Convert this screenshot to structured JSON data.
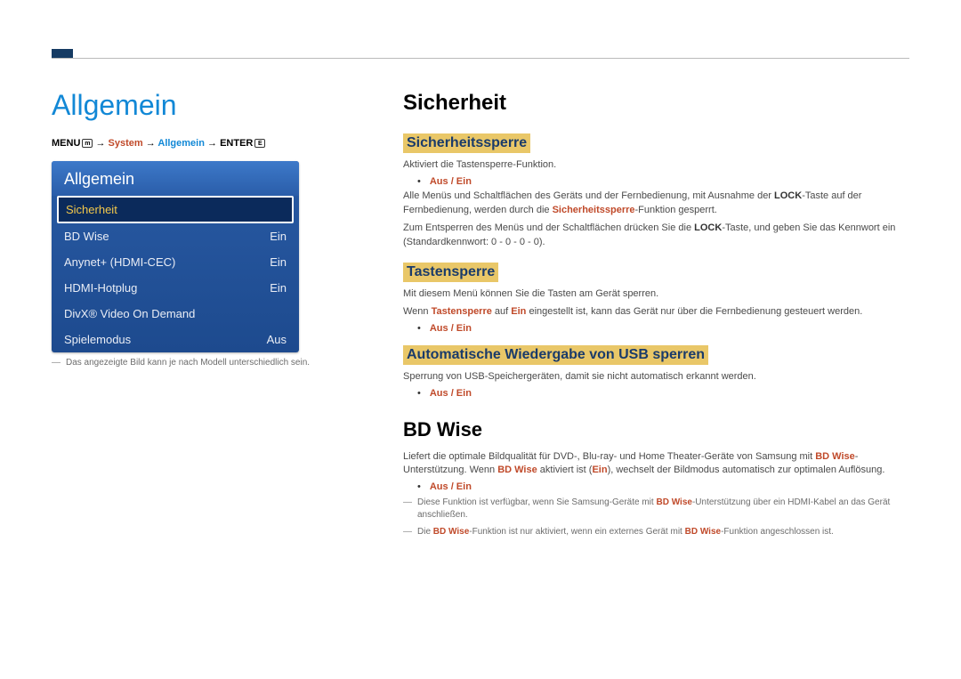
{
  "left": {
    "title": "Allgemein",
    "breadcrumb": {
      "menu": "MENU",
      "menu_icon": "m",
      "arrow": "→",
      "system": "System",
      "general": "Allgemein",
      "enter": "ENTER",
      "enter_icon": "E"
    },
    "menu_header": "Allgemein",
    "items": {
      "selected": "Sicherheit",
      "bd_wise": {
        "label": "BD Wise",
        "value": "Ein"
      },
      "anynet": {
        "label": "Anynet+ (HDMI-CEC)",
        "value": "Ein"
      },
      "hotplug": {
        "label": "HDMI-Hotplug",
        "value": "Ein"
      },
      "divx": {
        "label": "DivX® Video On Demand",
        "value": ""
      },
      "game": {
        "label": "Spielemodus",
        "value": "Aus"
      }
    },
    "note": "Das angezeigte Bild kann je nach Modell unterschiedlich sein."
  },
  "right": {
    "h1": "Sicherheit",
    "sec1": {
      "title": "Sicherheitssperre",
      "p1": "Aktiviert die Tastensperre-Funktion.",
      "bullet": "Aus / Ein",
      "p2a": "Alle Menüs und Schaltflächen des Geräts und der Fernbedienung, mit Ausnahme der ",
      "p2lock": "LOCK",
      "p2b": "-Taste auf der Fernbedienung, werden durch die ",
      "p2brand": "Sicherheitssperre",
      "p2c": "-Funktion gesperrt.",
      "p3a": "Zum Entsperren des Menüs und der Schaltflächen drücken Sie die ",
      "p3lock": "LOCK",
      "p3b": "-Taste, und geben Sie das Kennwort ein (Standardkennwort: 0 - 0 - 0 - 0)."
    },
    "sec2": {
      "title": "Tastensperre",
      "p1": "Mit diesem Menü können Sie die Tasten am Gerät sperren.",
      "p2a": "Wenn ",
      "p2b1": "Tastensperre",
      "p2c": " auf ",
      "p2b2": "Ein",
      "p2d": " eingestellt ist, kann das Gerät nur über die Fernbedienung gesteuert werden.",
      "bullet": "Aus / Ein"
    },
    "sec3": {
      "title": "Automatische Wiedergabe von USB sperren",
      "p1": "Sperrung von USB-Speichergeräten, damit sie nicht automatisch erkannt werden.",
      "bullet": "Aus / Ein"
    },
    "h2": "BD Wise",
    "bd": {
      "p1a": "Liefert die optimale Bildqualität für DVD-, Blu-ray- und Home Theater-Geräte von Samsung mit ",
      "p1b": "BD Wise",
      "p1c": "-Unterstützung. Wenn ",
      "p1d": "BD Wise",
      "p1e": " aktiviert ist (",
      "p1f": "Ein",
      "p1g": "), wechselt der Bildmodus automatisch zur optimalen Auflösung.",
      "bullet": "Aus / Ein",
      "n1a": "Diese Funktion ist verfügbar, wenn Sie Samsung-Geräte mit ",
      "n1b": "BD Wise",
      "n1c": "-Unterstützung über ein HDMI-Kabel an das Gerät anschließen.",
      "n2a": "Die ",
      "n2b": "BD Wise",
      "n2c": "-Funktion ist nur aktiviert, wenn ein externes Gerät mit ",
      "n2d": "BD Wise",
      "n2e": "-Funktion angeschlossen ist."
    }
  }
}
